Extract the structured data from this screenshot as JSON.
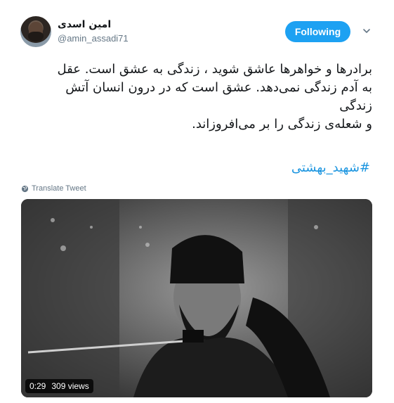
{
  "author": {
    "name": "امین اسدی",
    "handle": "@amin_assadi71",
    "avatar_icon": "profile-photo"
  },
  "follow_button": {
    "label": "Following",
    "color": "#1da1f2"
  },
  "menu_icon": "chevron-down-icon",
  "tweet": {
    "lines": [
      "برادرها و خواهرها عاشق شوید ، زندگی به عشق است. عقل",
      "به آدم زندگی نمی‌دهد. عشق است که در درون انسان آتش",
      "زندگی",
      "و شعله‌ی زندگی را بر می‌افروزاند."
    ],
    "hashtag": "#شهید_بهشتی",
    "hashtag_color": "#1b95e0"
  },
  "translate": {
    "label": "Translate Tweet",
    "icon": "globe-icon"
  },
  "video": {
    "duration": "0:29",
    "views": "309 views"
  }
}
